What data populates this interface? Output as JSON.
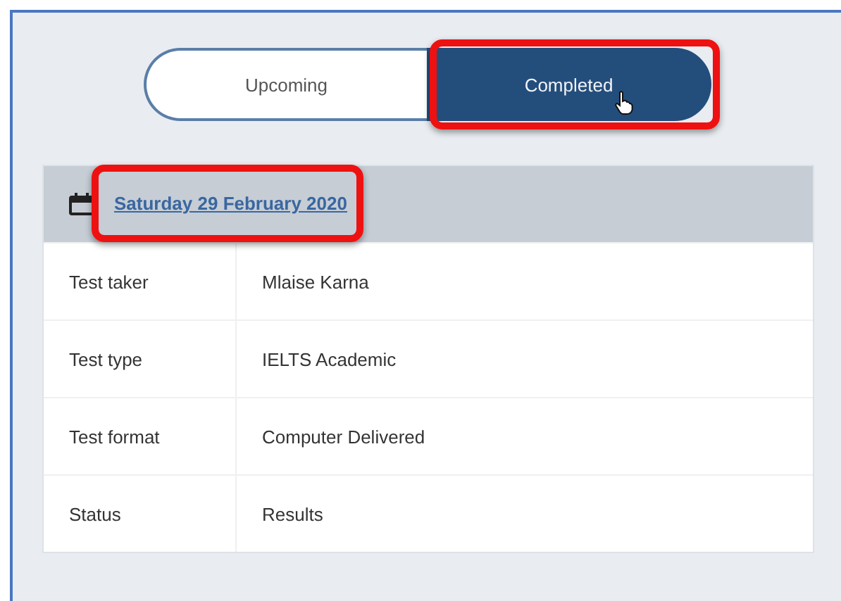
{
  "tabs": [
    {
      "label": "Upcoming",
      "selected": false,
      "highlighted": false
    },
    {
      "label": "Completed",
      "selected": true,
      "highlighted": true
    }
  ],
  "booking": {
    "date": "Saturday 29 February 2020",
    "date_highlighted": true,
    "rows": [
      {
        "label": "Test taker",
        "value": "Mlaise Karna"
      },
      {
        "label": "Test type",
        "value": "IELTS Academic"
      },
      {
        "label": "Test format",
        "value": "Computer Delivered"
      },
      {
        "label": "Status",
        "value": "Results"
      }
    ]
  }
}
